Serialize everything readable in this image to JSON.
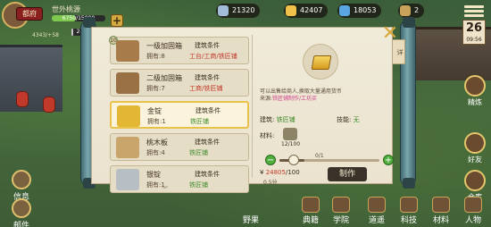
{
  "profile": {
    "title_badge": "都府",
    "name": "世外桃源",
    "exp_text": "6750/15000",
    "population": "4343/+58",
    "action_text": "245/4170"
  },
  "resources": [
    {
      "icon": "copper-coin-icon",
      "value": "21320",
      "color": "#a0bcd8"
    },
    {
      "icon": "food-icon",
      "value": "42407",
      "color": "#f0c24a"
    },
    {
      "icon": "prestige-icon",
      "value": "18053",
      "color": "#5aa6e0"
    },
    {
      "icon": "scroll-icon",
      "value": "2",
      "color": "#c9a35a"
    }
  ],
  "day": {
    "number": "26",
    "time": "09:56"
  },
  "craft_list": [
    {
      "badge": "10",
      "name": "一级加固箱",
      "own": "拥有:8",
      "cond_h": "建筑条件",
      "cond_parts": [
        {
          "t": "工台",
          "c": "red"
        },
        {
          "t": "/工商/铁匠铺",
          "c": "red"
        }
      ],
      "thumb": "#a77b4a"
    },
    {
      "badge": "",
      "name": "二级加固箱",
      "own": "拥有:7",
      "cond_h": "建筑条件",
      "cond_parts": [
        {
          "t": "工商/铁匠铺",
          "c": "red"
        }
      ],
      "thumb": "#9a7144"
    },
    {
      "badge": "",
      "name": "金锭",
      "own": "拥有:1",
      "cond_h": "建筑条件",
      "cond_parts": [
        {
          "t": "铁匠铺",
          "c": "grn"
        }
      ],
      "thumb": "#e2b734",
      "selected": true
    },
    {
      "badge": "",
      "name": "桃木板",
      "own": "拥有:4",
      "cond_h": "建筑条件",
      "cond_parts": [
        {
          "t": "铁匠铺",
          "c": "grn"
        }
      ],
      "thumb": "#c9a46b"
    },
    {
      "badge": "",
      "name": "银锭",
      "own": "拥有:1",
      "cond_h": "建筑条件",
      "cond_parts": [
        {
          "t": "铁匠铺",
          "c": "grn"
        }
      ],
      "thumb": "#b7bec4"
    }
  ],
  "detail": {
    "desc_line1": "可以出售给商人,换取大量通用货币",
    "desc_src_prefix": "来源:",
    "desc_src": "铁匠铺制作/工坊买",
    "req_label": "建筑: ",
    "req_value": "铁匠铺",
    "tech_label": "技能: ",
    "tech_value": "无",
    "mat_label": "材料:",
    "mat_count": "12/100",
    "qty": "0/1",
    "qty_fraction": 0.25,
    "cost_prefix": "¥ ",
    "cost_value": "24805",
    "cost_suffix": "/100",
    "time": "0.5分",
    "make_label": "制作"
  },
  "side_tab": "详",
  "right_buttons": [
    "精炼",
    "好友",
    "仓库"
  ],
  "bottom_buttons": [
    "野果",
    "典籍",
    "学院",
    "道遥",
    "科技",
    "材料",
    "人物"
  ],
  "left_buttons": [
    "信息",
    "邮件"
  ]
}
